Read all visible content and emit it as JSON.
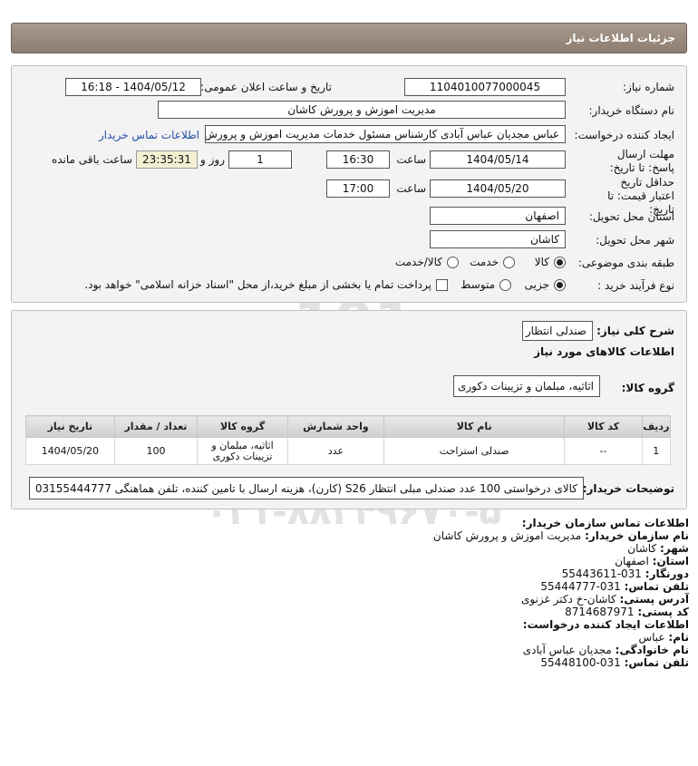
{
  "window": {
    "title": "جزئیات اطلاعات نیاز"
  },
  "form": {
    "need_number": {
      "label": "شماره نیاز:",
      "value": "1104010077000045"
    },
    "announce": {
      "label": "تاریخ و ساعت اعلان عمومی:",
      "value": "1404/05/12 - 16:18"
    },
    "buyer_org": {
      "label": "نام دستگاه خریدار:",
      "value": "مدیریت اموزش و پرورش کاشان"
    },
    "creator": {
      "label": "ایجاد کننده درخواست:",
      "value": "عباس مجدیان عباس آبادی کارشناس مسئول خدمات مدیریت اموزش و پرورش کاشان",
      "contact_link": "اطلاعات تماس خریدار"
    },
    "reply_deadline": {
      "label": "مهلت ارسال پاسخ: تا تاریخ:",
      "date": "1404/05/14",
      "time_label": "ساعت",
      "time": "16:30",
      "days": "1",
      "days_label": "روز و",
      "remaining": "23:35:31",
      "remaining_label": "ساعت باقی مانده"
    },
    "validity": {
      "label": "حداقل تاریخ اعتبار قیمت: تا تاریخ:",
      "date": "1404/05/20",
      "time_label": "ساعت",
      "time": "17:00"
    },
    "province": {
      "label": "استان محل تحویل:",
      "value": "اصفهان"
    },
    "city": {
      "label": "شهر محل تحویل:",
      "value": "کاشان"
    },
    "category": {
      "label": "طبقه بندی موضوعی:",
      "options": [
        "کالا",
        "خدمت",
        "کالا/خدمت"
      ],
      "selected": 0
    },
    "process": {
      "label": "نوع فرآیند خرید :",
      "options": [
        "جزیی",
        "متوسط"
      ],
      "selected": 0,
      "checkbox_text": "پرداخت تمام یا بخشی از مبلغ خرید،از محل \"اسناد خزانه اسلامی\" خواهد بود."
    }
  },
  "need": {
    "summary_label": "شرح کلی نیاز:",
    "summary": "صندلی انتظار",
    "goods_header": "اطلاعات کالاهای مورد نیاز",
    "group_label": "گروه کالا:",
    "group": "اثاثیه، مبلمان و تزیینات دکوری"
  },
  "table": {
    "headers": [
      "ردیف",
      "کد کالا",
      "نام کالا",
      "واحد شمارش",
      "گروه کالا",
      "تعداد / مقدار",
      "تاریخ نیاز"
    ],
    "rows": [
      [
        "1",
        "--",
        "صندلی استراحت",
        "عدد",
        "اثاثیه، مبلمان و تزیینات دکوری",
        "100",
        "1404/05/20"
      ]
    ]
  },
  "buyer_notes": {
    "label": "توضیحات خریدار:",
    "text": "کالای درخواستی 100 عدد صندلی مبلی انتظار S26 (کارن)، هزینه ارسال با تامین کننده، تلفن هماهنگی 03155444777"
  },
  "contact": {
    "lines": [
      {
        "k": "اطلاعات تماس سازمان خریدار:",
        "v": ""
      },
      {
        "k": "نام سازمان خریدار:",
        "v": "مدیریت اموزش و پرورش کاشان"
      },
      {
        "k": "شهر:",
        "v": "کاشان"
      },
      {
        "k": "استان:",
        "v": "اصفهان"
      },
      {
        "k": "دورنگار:",
        "v": "031-55443611"
      },
      {
        "k": "تلفن تماس:",
        "v": "031-55444777"
      },
      {
        "k": "آدرس پستی:",
        "v": "کاشان-خ دکتر غزنوی"
      },
      {
        "k": "کد پستی:",
        "v": "8714687971"
      },
      {
        "k": "اطلاعات ایجاد کننده درخواست:",
        "v": ""
      },
      {
        "k": "نام:",
        "v": "عباس"
      },
      {
        "k": "نام خانوادگی:",
        "v": "مجدیان عباس آبادی"
      },
      {
        "k": "تلفن تماس:",
        "v": "031-55448100"
      }
    ]
  }
}
